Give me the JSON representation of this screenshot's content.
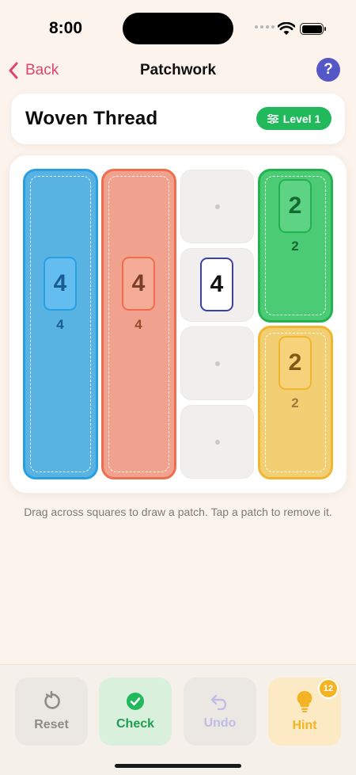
{
  "status": {
    "time": "8:00"
  },
  "nav": {
    "back_label": "Back",
    "title": "Patchwork",
    "help_label": "?"
  },
  "puzzle": {
    "name": "Woven Thread",
    "level_label": "Level 1"
  },
  "board": {
    "patches": [
      {
        "id": "blue",
        "fill": "#58b3e3",
        "border": "#2a9ee3",
        "clue_value": "4",
        "clue_text_color": "#1a5c94",
        "sub_value": "4"
      },
      {
        "id": "red",
        "fill": "#f1a28e",
        "border": "#ee6d4f",
        "clue_value": "4",
        "clue_text_color": "#7a3f2b",
        "sub_value": "4"
      },
      {
        "id": "green",
        "fill": "#4ccb75",
        "border": "#22b24f",
        "clue_value": "2",
        "clue_text_color": "#126b33",
        "sub_value": "2"
      },
      {
        "id": "yellow",
        "fill": "#f3cf74",
        "border": "#f0b632",
        "clue_value": "2",
        "clue_text_color": "#7d5a18",
        "sub_value": "2"
      }
    ],
    "free_clue": {
      "value": "4",
      "border": "#3b3fb0"
    }
  },
  "instruction": "Drag across squares to draw a patch. Tap a patch to remove it.",
  "toolbar": {
    "reset_label": "Reset",
    "check_label": "Check",
    "undo_label": "Undo",
    "hint_label": "Hint",
    "hint_count": "12"
  }
}
